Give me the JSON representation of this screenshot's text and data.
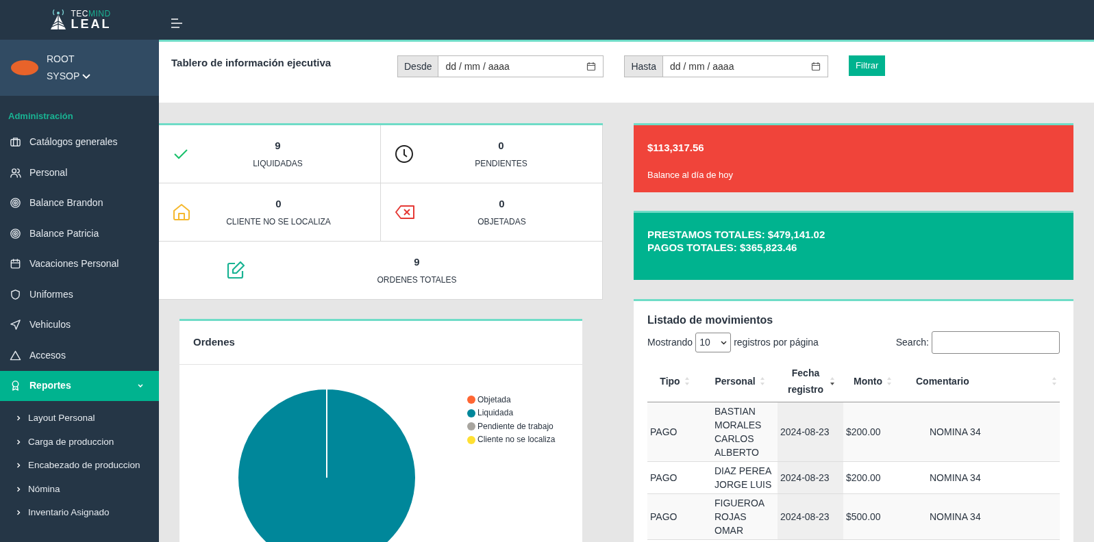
{
  "brand": {
    "line1_a": "TEC",
    "line1_b": "MIND",
    "line2": "LEAL"
  },
  "user": {
    "name": "ROOT",
    "role": "SYSOP"
  },
  "sidebar": {
    "section": "Administración",
    "items": [
      {
        "label": "Catálogos generales",
        "selected": false
      },
      {
        "label": "Personal",
        "selected": false
      },
      {
        "label": "Balance Brandon",
        "selected": false
      },
      {
        "label": "Balance Patricia",
        "selected": false
      },
      {
        "label": "Vacaciones Personal",
        "selected": false
      },
      {
        "label": "Uniformes",
        "selected": false
      },
      {
        "label": "Vehiculos",
        "selected": false
      },
      {
        "label": "Accesos",
        "selected": false
      },
      {
        "label": "Reportes",
        "selected": true,
        "expanded": true,
        "children": [
          {
            "label": "Layout Personal"
          },
          {
            "label": "Carga de produccion"
          },
          {
            "label": "Encabezado de produccion"
          },
          {
            "label": "Nómina"
          },
          {
            "label": "Inventario Asignado"
          }
        ]
      }
    ]
  },
  "header": {
    "title": "Tablero de información ejecutiva",
    "from_label": "Desde",
    "from_placeholder": "dd / mm / aaaa",
    "to_label": "Hasta",
    "to_placeholder": "dd / mm / aaaa",
    "button": "Filtrar"
  },
  "stats": [
    {
      "kind": "check",
      "value": "9",
      "label": "LIQUIDADAS"
    },
    {
      "kind": "clock",
      "value": "0",
      "label": "PENDIENTES"
    },
    {
      "kind": "home",
      "value": "0",
      "label": "CLIENTE NO SE LOCALIZA"
    },
    {
      "kind": "reject",
      "value": "0",
      "label": "OBJETADAS"
    },
    {
      "kind": "edit",
      "value": "9",
      "label": "ORDENES TOTALES"
    }
  ],
  "balance": {
    "amount": "$113,317.56",
    "caption": "Balance al día de hoy"
  },
  "totals": {
    "loans": "PRESTAMOS TOTALES: $479,141.02",
    "payments": "PAGOS TOTALES: $365,823.46"
  },
  "orders": {
    "title": "Ordenes",
    "chart_data": {
      "type": "pie",
      "categories": [
        "Objetada",
        "Liquidada",
        "Pendiente de trabajo",
        "Cliente no se localiza"
      ],
      "values": [
        0,
        100,
        0,
        0
      ],
      "colors": [
        "#ff6633",
        "#00879a",
        "#a8a59f",
        "#ffe033"
      ]
    }
  },
  "movements": {
    "title": "Listado de movimientos",
    "length_before": "Mostrando",
    "length_value": "10",
    "length_after": "registros por página",
    "search_label": "Search:",
    "columns": [
      {
        "label": "Tipo",
        "sorted": false
      },
      {
        "label": "Personal",
        "sorted": false
      },
      {
        "label": "Fecha registro",
        "sorted": true
      },
      {
        "label": "Monto",
        "sorted": false
      },
      {
        "label": "Comentario",
        "sorted": false
      }
    ],
    "rows": [
      [
        "PAGO",
        "BASTIAN MORALES CARLOS ALBERTO",
        "2024-08-23",
        "$200.00",
        "NOMINA 34"
      ],
      [
        "PAGO",
        "DIAZ PEREA JORGE LUIS",
        "2024-08-23",
        "$200.00",
        "NOMINA 34"
      ],
      [
        "PAGO",
        "FIGUEROA ROJAS OMAR",
        "2024-08-23",
        "$500.00",
        "NOMINA 34"
      ]
    ]
  }
}
